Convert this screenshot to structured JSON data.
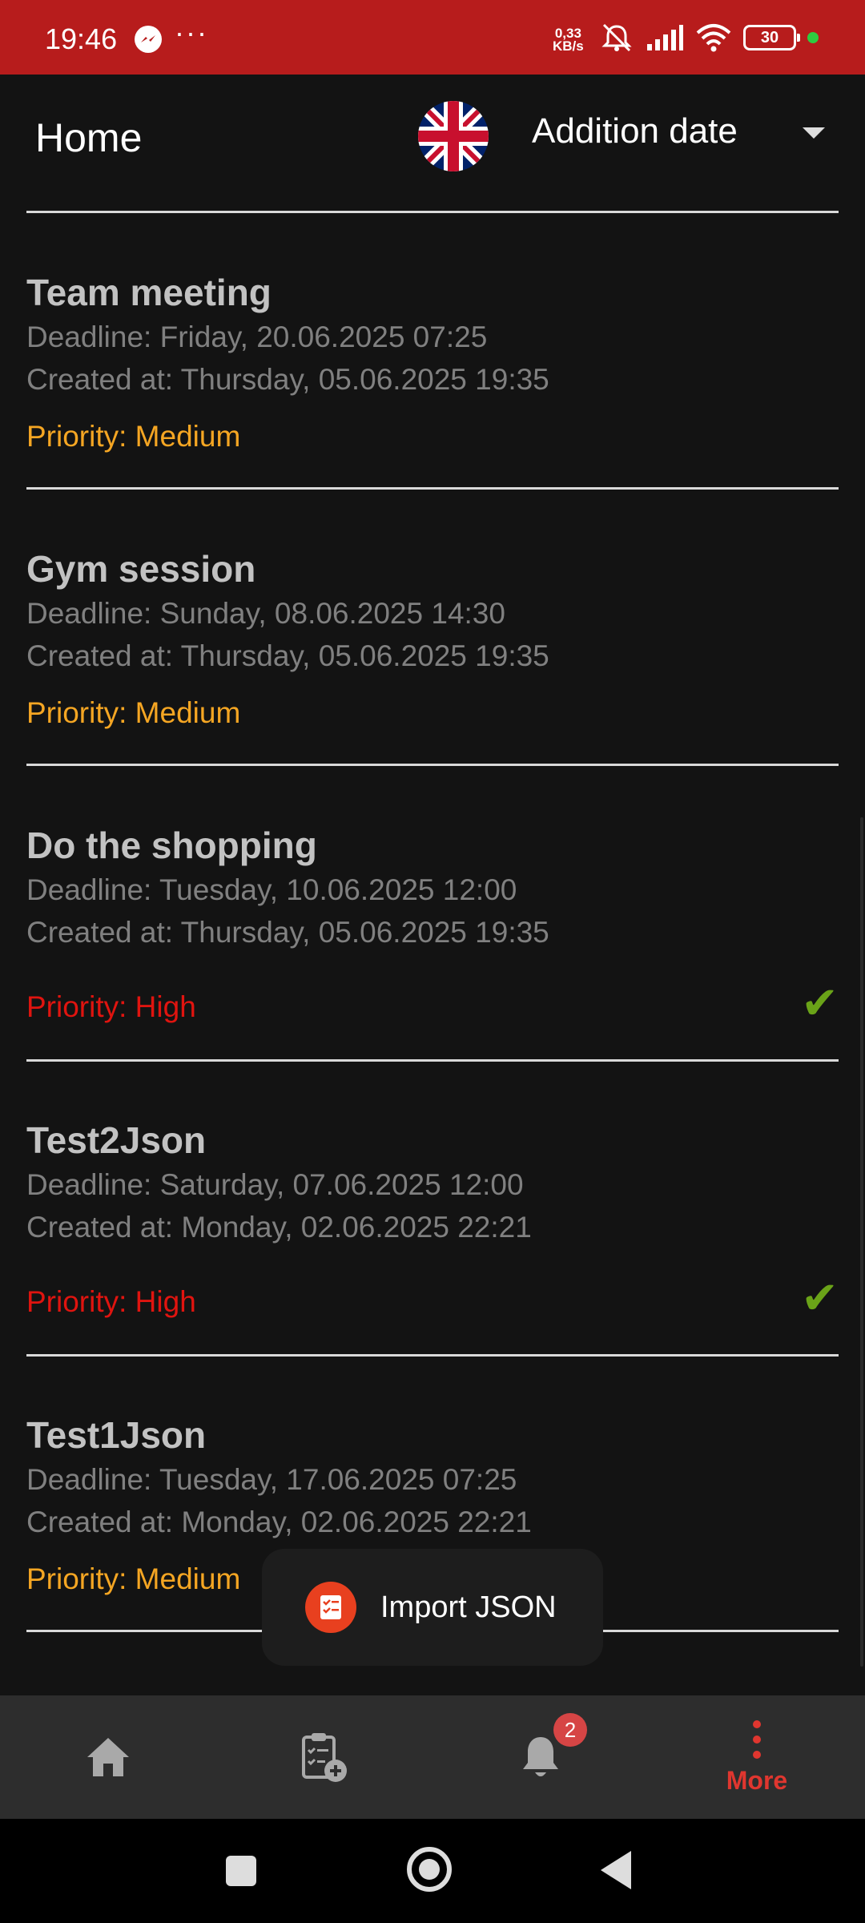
{
  "status_bar": {
    "time": "19:46",
    "notification_icons": [
      "messenger-icon",
      "more-dots-icon"
    ],
    "network_speed": "0,33\nKB/s",
    "battery": "30",
    "status_icons": [
      "mute-icon",
      "signal-icon",
      "wifi-icon",
      "battery-icon",
      "active-dot"
    ]
  },
  "header": {
    "title": "Home",
    "language_flag": "uk-flag-icon",
    "sort": {
      "selected": "Addition date"
    }
  },
  "tasks": [
    {
      "title": "Team meeting",
      "deadline": "Deadline: Friday, 20.06.2025 07:25",
      "created": "Created at: Thursday, 05.06.2025 19:35",
      "priority": "Priority: Medium",
      "priority_level": "Medium",
      "completed": false
    },
    {
      "title": "Gym session",
      "deadline": "Deadline: Sunday, 08.06.2025 14:30",
      "created": "Created at: Thursday, 05.06.2025 19:35",
      "priority": "Priority: Medium",
      "priority_level": "Medium",
      "completed": false
    },
    {
      "title": "Do the shopping",
      "deadline": "Deadline: Tuesday, 10.06.2025 12:00",
      "created": "Created at: Thursday, 05.06.2025 19:35",
      "priority": "Priority: High",
      "priority_level": "High",
      "completed": true
    },
    {
      "title": "Test2Json",
      "deadline": "Deadline: Saturday, 07.06.2025 12:00",
      "created": "Created at: Monday, 02.06.2025 22:21",
      "priority": "Priority: High",
      "priority_level": "High",
      "completed": true
    },
    {
      "title": "Test1Json",
      "deadline": "Deadline: Tuesday, 17.06.2025 07:25",
      "created": "Created at: Monday, 02.06.2025 22:21",
      "priority": "Priority: Medium",
      "priority_level": "Medium",
      "completed": false
    }
  ],
  "colors": {
    "status_bar": "#b71c1c",
    "priority_medium": "#f5a623",
    "priority_high": "#e0140f",
    "check": "#6aa318",
    "accent": "#e0362f"
  },
  "toast": {
    "icon": "checklist-icon",
    "text": "Import JSON"
  },
  "bottom_nav": {
    "items": [
      {
        "icon": "home-icon",
        "label": ""
      },
      {
        "icon": "add-task-icon",
        "label": ""
      },
      {
        "icon": "bell-icon",
        "label": "",
        "badge": "2"
      },
      {
        "icon": "more-vert-icon",
        "label": "More",
        "active": true
      }
    ]
  },
  "system_nav": [
    "recents-button",
    "home-button",
    "back-button"
  ]
}
